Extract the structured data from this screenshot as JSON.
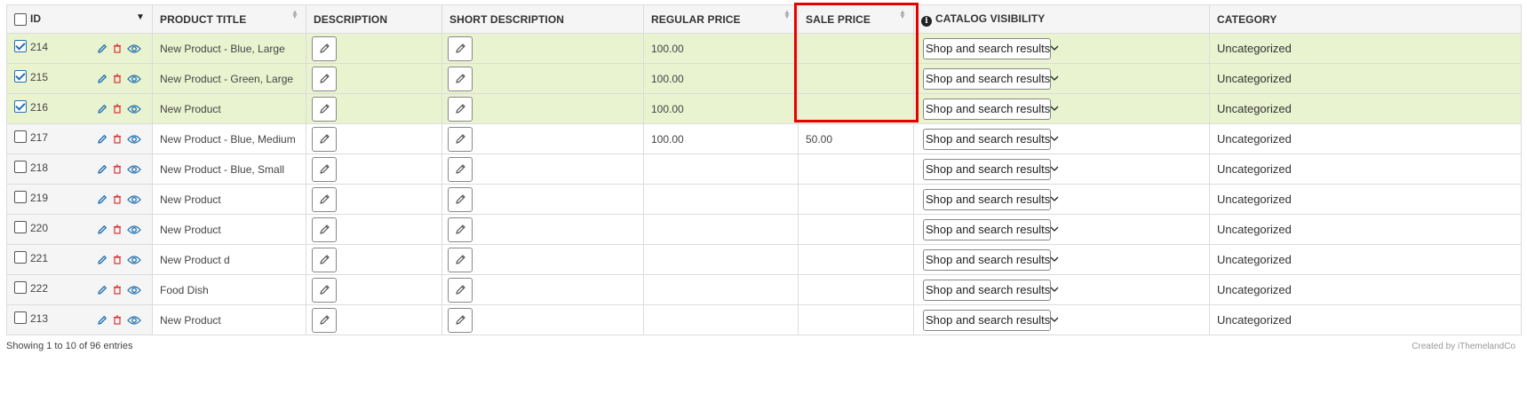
{
  "header": {
    "id": "ID",
    "product_title": "PRODUCT TITLE",
    "description": "DESCRIPTION",
    "short_description": "SHORT DESCRIPTION",
    "regular_price": "REGULAR PRICE",
    "sale_price": "SALE PRICE",
    "catalog_visibility": "CATALOG VISIBILITY",
    "category": "CATEGORY"
  },
  "rows": [
    {
      "id": "214",
      "checked": true,
      "title": "New Product - Blue, Large",
      "regular_price": "100.00",
      "sale_price": "",
      "visibility": "Shop and search results",
      "category": "Uncategorized"
    },
    {
      "id": "215",
      "checked": true,
      "title": "New Product - Green, Large",
      "regular_price": "100.00",
      "sale_price": "",
      "visibility": "Shop and search results",
      "category": "Uncategorized"
    },
    {
      "id": "216",
      "checked": true,
      "title": "New Product",
      "regular_price": "100.00",
      "sale_price": "",
      "visibility": "Shop and search results",
      "category": "Uncategorized"
    },
    {
      "id": "217",
      "checked": false,
      "title": "New Product - Blue, Medium",
      "regular_price": "100.00",
      "sale_price": "50.00",
      "visibility": "Shop and search results",
      "category": "Uncategorized"
    },
    {
      "id": "218",
      "checked": false,
      "title": "New Product - Blue, Small",
      "regular_price": "",
      "sale_price": "",
      "visibility": "Shop and search results",
      "category": "Uncategorized"
    },
    {
      "id": "219",
      "checked": false,
      "title": "New Product",
      "regular_price": "",
      "sale_price": "",
      "visibility": "Shop and search results",
      "category": "Uncategorized"
    },
    {
      "id": "220",
      "checked": false,
      "title": "New Product",
      "regular_price": "",
      "sale_price": "",
      "visibility": "Shop and search results",
      "category": "Uncategorized"
    },
    {
      "id": "221",
      "checked": false,
      "title": "New Product d",
      "regular_price": "",
      "sale_price": "",
      "visibility": "Shop and search results",
      "category": "Uncategorized"
    },
    {
      "id": "222",
      "checked": false,
      "title": "Food Dish",
      "regular_price": "",
      "sale_price": "",
      "visibility": "Shop and search results",
      "category": "Uncategorized"
    },
    {
      "id": "213",
      "checked": false,
      "title": "New Product",
      "regular_price": "",
      "sale_price": "",
      "visibility": "Shop and search results",
      "category": "Uncategorized"
    }
  ],
  "footer": {
    "entries": "Showing 1 to 10 of 96 entries",
    "credit": "Created by iThemelandCo"
  },
  "colors": {
    "selected_row": "#eaf3d0",
    "highlight": "#e60000",
    "edit_icon": "#2271b1",
    "delete_icon": "#d63638",
    "view_icon": "#2271b1"
  },
  "icons": {
    "edit": "pencil-icon",
    "delete": "trash-icon",
    "view": "eye-icon",
    "edit_text": "pencil-icon",
    "info": "info-icon",
    "select": "chevron-down-icon"
  }
}
